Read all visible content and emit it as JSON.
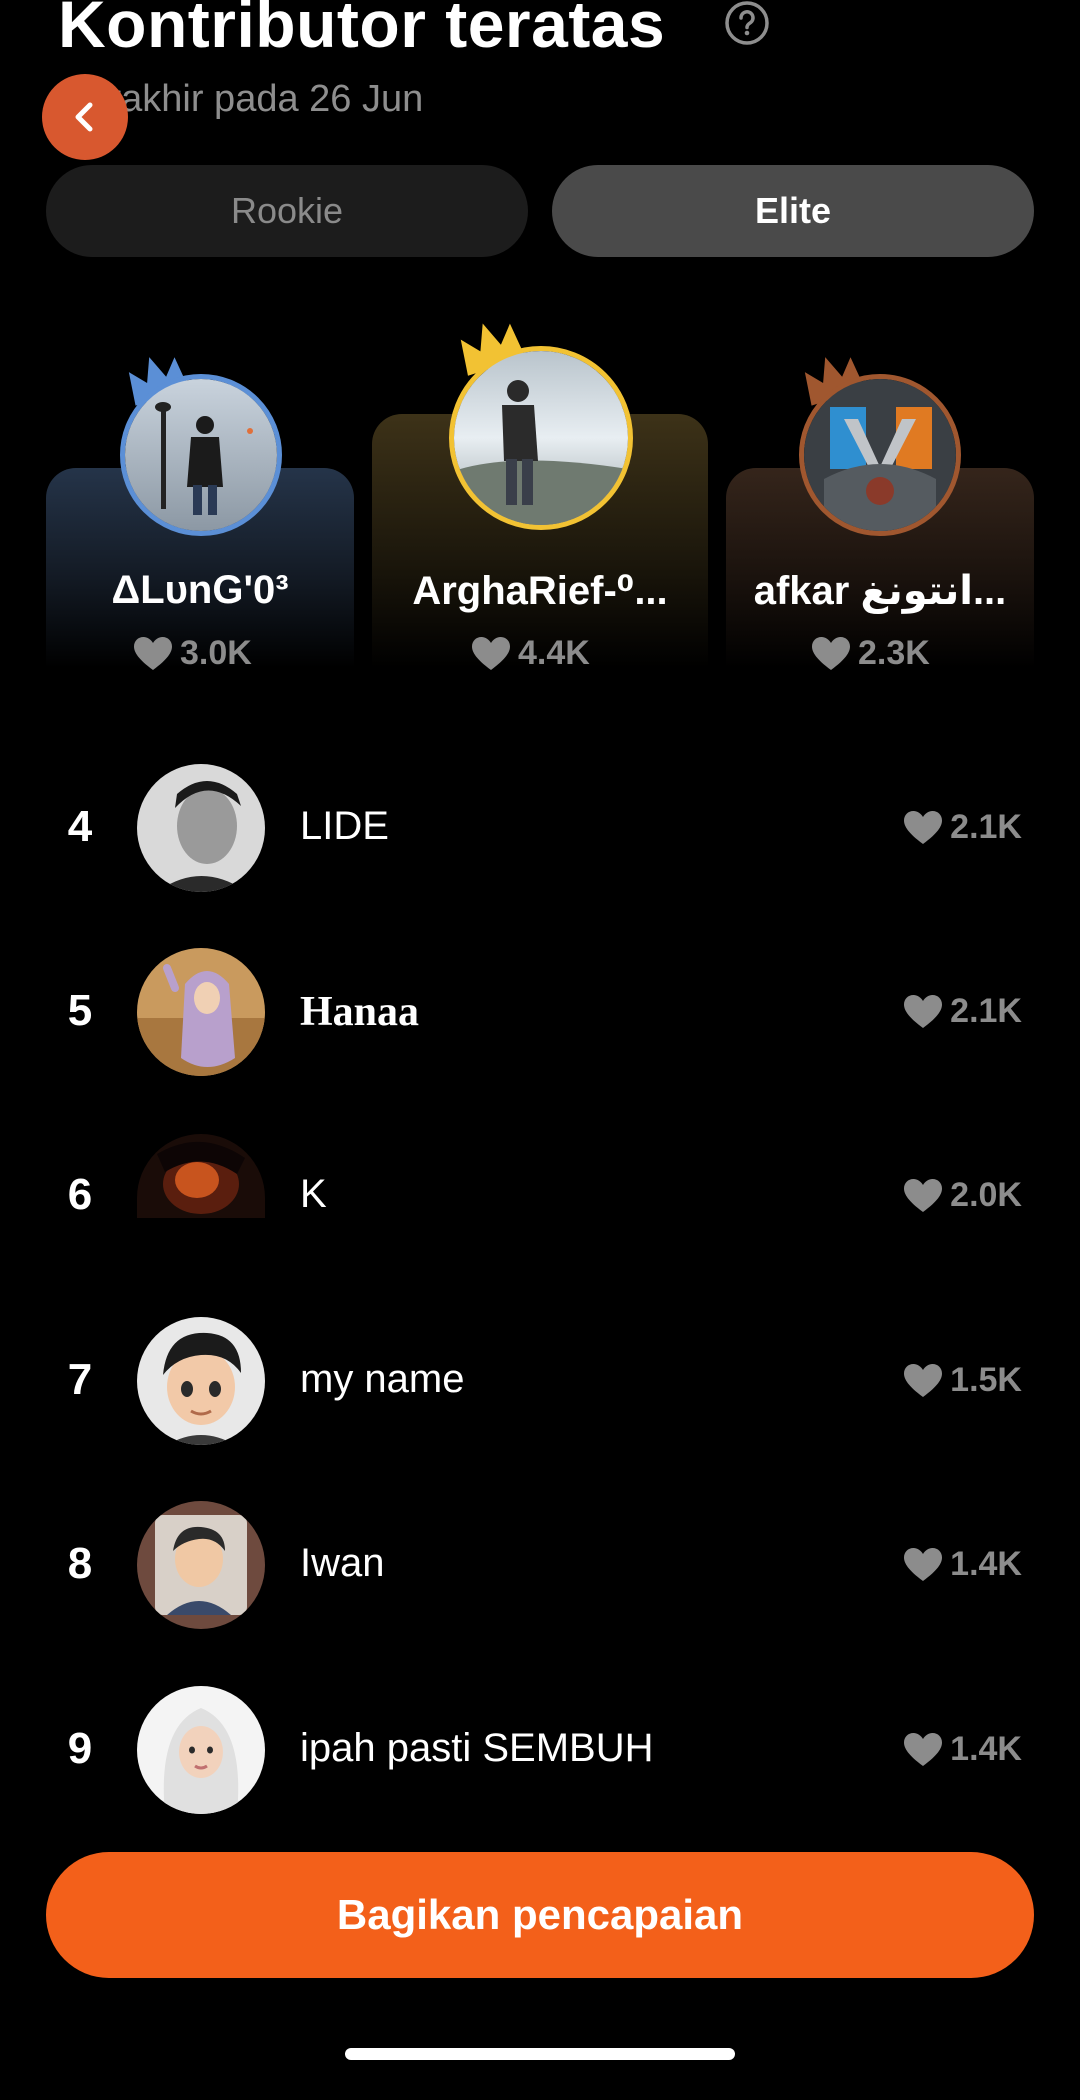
{
  "header": {
    "title": "Kontributor teratas",
    "subtitle": "Berakhir pada 26 Jun",
    "help_icon": "question-circle-icon",
    "back_icon": "chevron-left-icon"
  },
  "tabs": [
    {
      "label": "Rookie",
      "selected": false
    },
    {
      "label": "Elite",
      "selected": true
    }
  ],
  "podium": [
    {
      "place": 2,
      "name": "ΔLᴜnG'0³",
      "likes": "3.0K",
      "ring_color": "#5b8fd6"
    },
    {
      "place": 1,
      "name": "ArghaRief-⁰...",
      "likes": "4.4K",
      "ring_color": "#f2c233"
    },
    {
      "place": 3,
      "name": "afkar انتونغ...",
      "likes": "2.3K",
      "ring_color": "#a0572f"
    }
  ],
  "list": [
    {
      "rank": "4",
      "name": "LIDE",
      "likes": "2.1K"
    },
    {
      "rank": "5",
      "name": "Hanaa",
      "likes": "2.1K"
    },
    {
      "rank": "6",
      "name": "K",
      "likes": "2.0K"
    },
    {
      "rank": "7",
      "name": "my name",
      "likes": "1.5K"
    },
    {
      "rank": "8",
      "name": "Iwan",
      "likes": "1.4K"
    },
    {
      "rank": "9",
      "name": "ipah pasti SEMBUH",
      "likes": "1.4K"
    }
  ],
  "share_button": {
    "label": "Bagikan pencapaian"
  },
  "colors": {
    "accent": "#f3601a",
    "back_button": "#d8582f",
    "gold": "#f2c233",
    "silver_blue": "#5b8fd6",
    "bronze": "#a0572f"
  }
}
